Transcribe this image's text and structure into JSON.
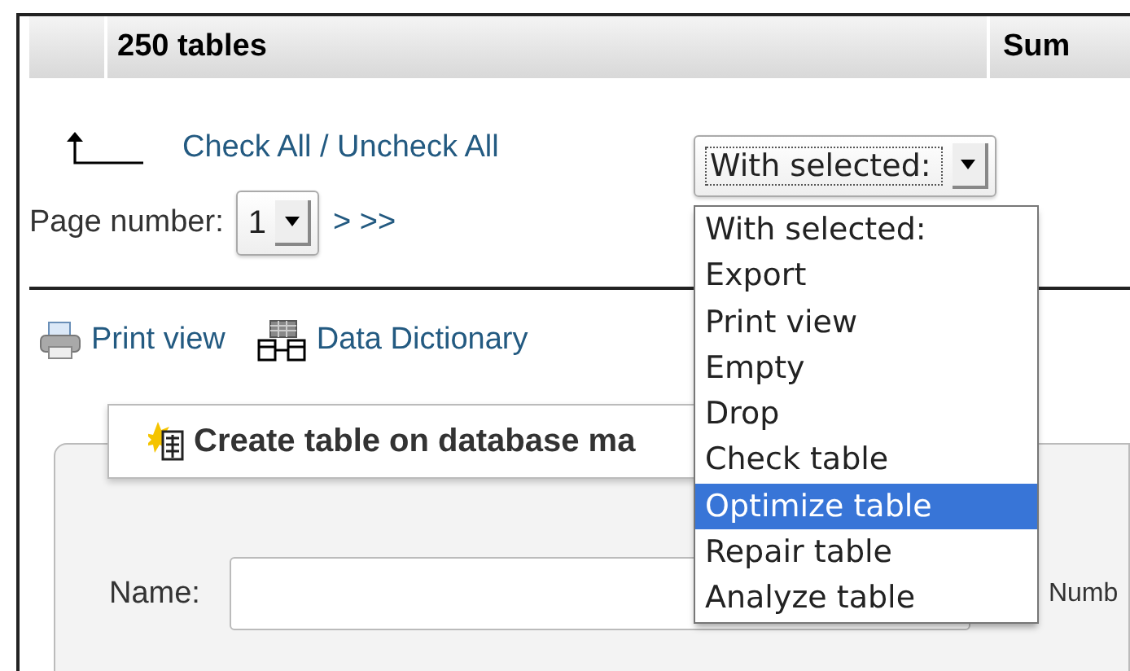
{
  "table_header": {
    "columns": [
      {
        "label": "250 tables"
      },
      {
        "label": "Sum"
      }
    ]
  },
  "check_links": {
    "check_all": "Check All",
    "separator": "/",
    "uncheck_all": "Uncheck All"
  },
  "with_selected": {
    "value": "With selected:",
    "expanded": true,
    "options": [
      {
        "label": "With selected:",
        "highlighted": false
      },
      {
        "label": "Export",
        "highlighted": false
      },
      {
        "label": "Print view",
        "highlighted": false
      },
      {
        "label": "Empty",
        "highlighted": false
      },
      {
        "label": "Drop",
        "highlighted": false
      },
      {
        "label": "Check table",
        "highlighted": false
      },
      {
        "label": "Optimize table",
        "highlighted": true
      },
      {
        "label": "Repair table",
        "highlighted": false
      },
      {
        "label": "Analyze table",
        "highlighted": false
      }
    ]
  },
  "pagination": {
    "label": "Page number:",
    "value": "1",
    "links": [
      ">",
      ">>"
    ]
  },
  "actions": [
    {
      "kind": "print",
      "label": "Print view"
    },
    {
      "kind": "dictionary",
      "label": "Data Dictionary"
    }
  ],
  "create_table": {
    "legend": "Create table on database ma",
    "name_label": "Name:",
    "number_label": "Numb"
  }
}
